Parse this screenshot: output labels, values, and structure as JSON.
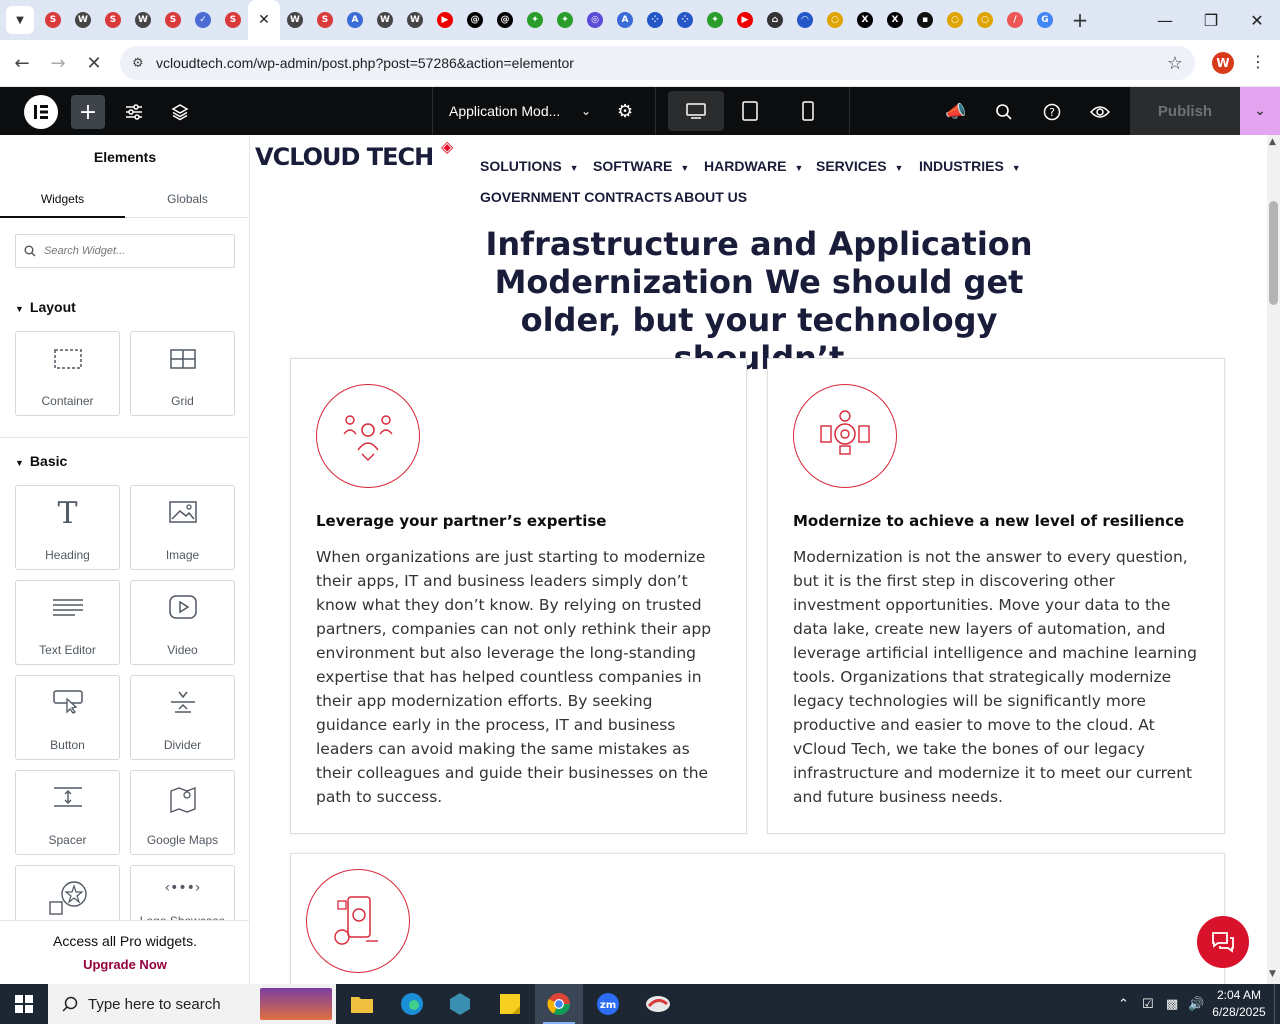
{
  "browser": {
    "tabs": [
      {
        "icon": "snagit-icon",
        "color": "#d93a3a"
      },
      {
        "icon": "wordpress-icon",
        "color": "#464646"
      },
      {
        "icon": "snagit-icon",
        "color": "#d93a3a"
      },
      {
        "icon": "wordpress-icon",
        "color": "#464646"
      },
      {
        "icon": "snagit-icon",
        "color": "#d93a3a"
      },
      {
        "icon": "check-icon",
        "color": "#4a6cd4"
      },
      {
        "icon": "snagit-icon",
        "color": "#d93a3a"
      },
      {
        "icon": "close-tab-icon",
        "color": "#222"
      },
      {
        "icon": "wordpress-icon",
        "color": "#464646"
      },
      {
        "icon": "snagit-icon",
        "color": "#d93a3a"
      },
      {
        "icon": "translate-icon",
        "color": "#3b6bd6"
      },
      {
        "icon": "wordpress-icon",
        "color": "#464646"
      },
      {
        "icon": "wordpress-icon",
        "color": "#464646"
      },
      {
        "icon": "youtube-icon",
        "color": "#e00"
      },
      {
        "icon": "threads-icon",
        "color": "#000"
      },
      {
        "icon": "threads-icon",
        "color": "#000"
      },
      {
        "icon": "leaf-icon",
        "color": "#2a9d2a"
      },
      {
        "icon": "leaf-icon",
        "color": "#2a9d2a"
      },
      {
        "icon": "spiral-icon",
        "color": "#5b4bd6"
      },
      {
        "icon": "translate-icon",
        "color": "#3b6bd6"
      },
      {
        "icon": "grid-dots-icon",
        "color": "#2456c8"
      },
      {
        "icon": "grid-dots-icon",
        "color": "#2456c8"
      },
      {
        "icon": "leaf-icon",
        "color": "#2a9d2a"
      },
      {
        "icon": "youtube-icon",
        "color": "#e00"
      },
      {
        "icon": "lock-icon",
        "color": "#333"
      },
      {
        "icon": "arc-icon",
        "color": "#2456c8"
      },
      {
        "icon": "circle-icon",
        "color": "#e0a400"
      },
      {
        "icon": "x-icon",
        "color": "#000"
      },
      {
        "icon": "x-icon",
        "color": "#000"
      },
      {
        "icon": "box-icon",
        "color": "#111"
      },
      {
        "icon": "circle-icon",
        "color": "#e0a400"
      },
      {
        "icon": "circle-icon",
        "color": "#e0a400"
      },
      {
        "icon": "slash-icon",
        "color": "#e55"
      },
      {
        "icon": "google-icon",
        "color": "#4285f4"
      }
    ],
    "url": "vcloudtech.com/wp-admin/post.php?post=57286&action=elementor",
    "profile_initial": "W"
  },
  "elementor": {
    "doc_title": "Application Mod...",
    "publish_label": "Publish",
    "panel": {
      "title": "Elements",
      "tabs": [
        "Widgets",
        "Globals"
      ],
      "search_placeholder": "Search Widget...",
      "sections": [
        {
          "name": "Layout",
          "widgets": [
            "Container",
            "Grid"
          ]
        },
        {
          "name": "Basic",
          "widgets": [
            "Heading",
            "Image",
            "Text Editor",
            "Video",
            "Button",
            "Divider",
            "Spacer",
            "Google Maps",
            "",
            "Logo Showcase"
          ]
        }
      ],
      "promo_text": "Access all Pro widgets.",
      "promo_link": "Upgrade Now"
    }
  },
  "site": {
    "logo_text": "VCLOUD TECH",
    "nav": [
      {
        "label": "SOLUTIONS",
        "dropdown": true
      },
      {
        "label": "SOFTWARE",
        "dropdown": true
      },
      {
        "label": "HARDWARE",
        "dropdown": true
      },
      {
        "label": "SERVICES",
        "dropdown": true
      },
      {
        "label": "INDUSTRIES",
        "dropdown": true
      },
      {
        "label": "GOVERNMENT CONTRACTS",
        "dropdown": false
      },
      {
        "label": "ABOUT US",
        "dropdown": false
      }
    ],
    "hero_title": "Infrastructure and Application Modernization We should get older, but your technology shouldn’t",
    "cards": [
      {
        "title": "Leverage your partner’s expertise",
        "body": "When organizations are just starting to modernize their apps, IT and business leaders simply don’t know what they don’t know. By relying on trusted partners, companies can not only rethink their app environment but also leverage the long-standing expertise that has helped countless companies in their app modernization efforts. By seeking guidance early in the process, IT and business leaders can avoid making the same mistakes as their colleagues and guide their businesses on the path to success."
      },
      {
        "title": "Modernize to achieve a new level of resilience",
        "body": "Modernization is not the answer to every question, but it is the first step in discovering other investment opportunities. Move your data to the data lake, create new layers of automation, and leverage artificial intelligence and machine learning tools. Organizations that strategically modernize legacy technologies will be significantly more productive and easier to move to the cloud. At vCloud Tech, we take the bones of our legacy infrastructure and modernize it to meet our current and future business needs."
      }
    ],
    "accent_color": "#d8283a",
    "navy_color": "#1a1d3a"
  },
  "taskbar": {
    "search_placeholder": "Type here to search",
    "time": "2:04 AM",
    "date": "6/28/2025"
  }
}
